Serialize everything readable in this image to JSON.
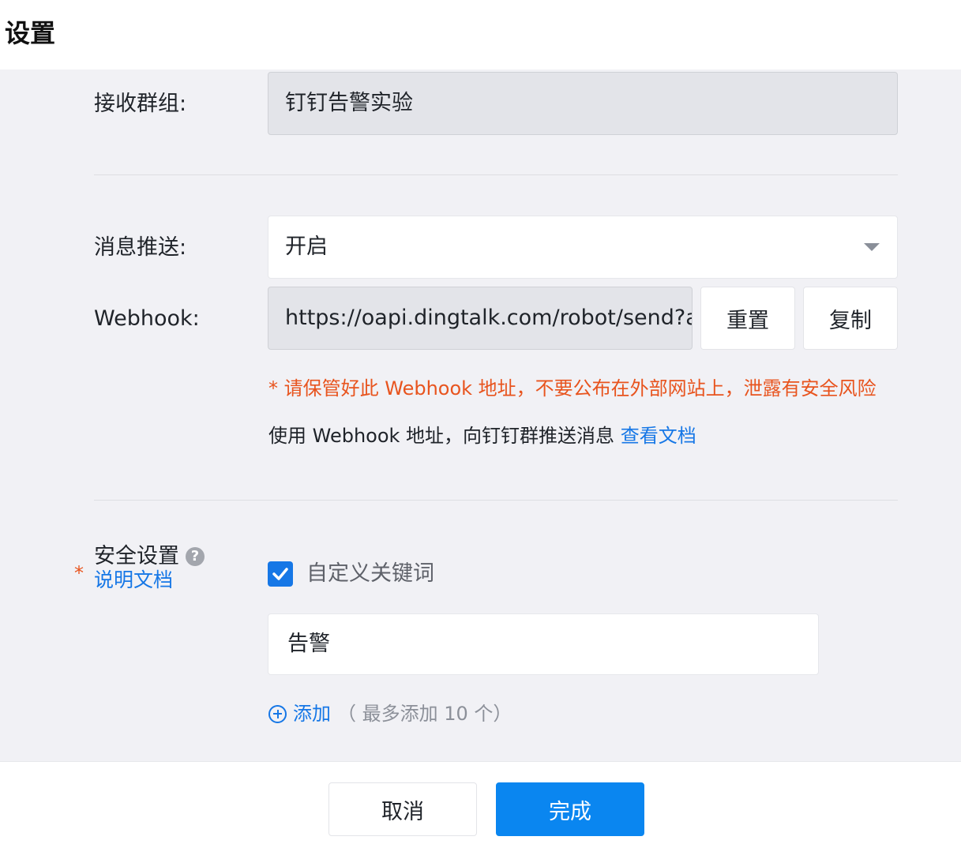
{
  "header": {
    "title": "设置"
  },
  "form": {
    "group": {
      "label": "接收群组:",
      "value": "钉钉告警实验"
    },
    "push": {
      "label": "消息推送:",
      "value": "开启"
    },
    "webhook": {
      "label": "Webhook:",
      "value": "https://oapi.dingtalk.com/robot/send?ac",
      "reset_label": "重置",
      "copy_label": "复制"
    },
    "warning": "* 请保管好此 Webhook 地址，不要公布在外部网站上，泄露有安全风险",
    "hint_text": "使用 Webhook 地址，向钉钉群推送消息",
    "hint_link": "查看文档",
    "security": {
      "required_mark": "*",
      "label": "安全设置",
      "help_icon": "question-circle-icon",
      "doc_link": "说明文档",
      "checkbox_label": "自定义关键词",
      "checked": true,
      "keyword": "告警",
      "add_label": "添加",
      "add_note": "（ 最多添加 10 个）"
    }
  },
  "footer": {
    "cancel_label": "取消",
    "done_label": "完成"
  },
  "colors": {
    "primary": "#0a86f0",
    "link": "#1677e6",
    "warning": "#e8541e",
    "panel_bg": "#f1f1f5"
  }
}
